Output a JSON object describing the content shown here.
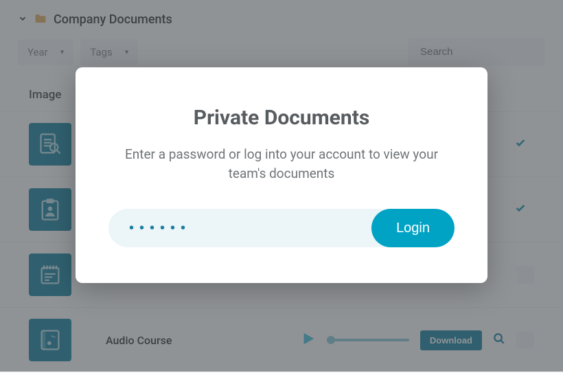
{
  "header": {
    "title": "Company Documents"
  },
  "filters": {
    "year": "Year",
    "tags": "Tags",
    "search_placeholder": "Search"
  },
  "table": {
    "image_col": "Image"
  },
  "rows": {
    "audio_title": "Audio Course",
    "download_label": "Download"
  },
  "modal": {
    "title": "Private Documents",
    "subtitle": "Enter a password or log into your account to view your team's documents",
    "password_value": "••••••",
    "login_label": "Login"
  }
}
